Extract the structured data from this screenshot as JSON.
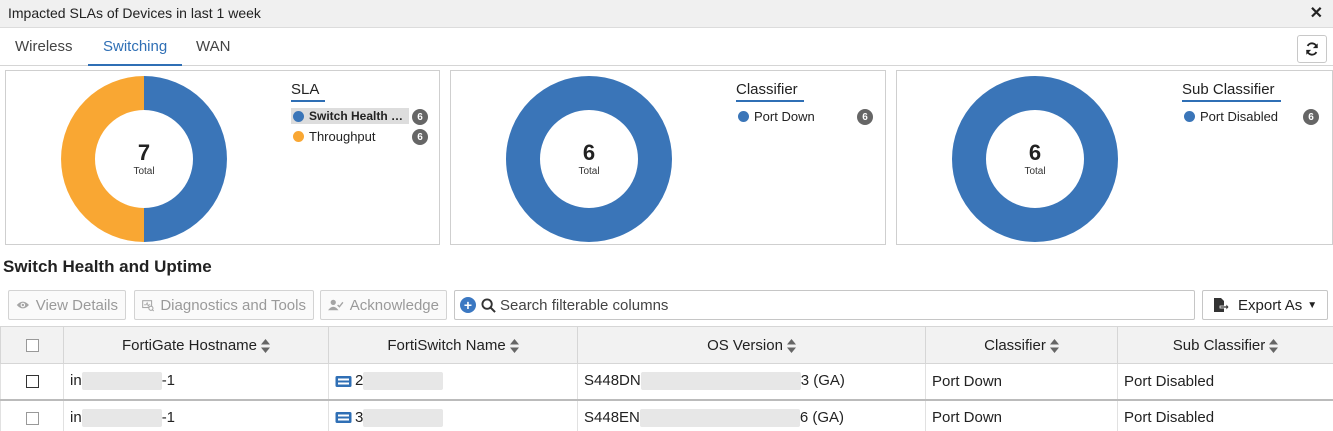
{
  "window": {
    "title": "Impacted SLAs of Devices in last 1 week"
  },
  "tabs": [
    {
      "label": "Wireless"
    },
    {
      "label": "Switching"
    },
    {
      "label": "WAN"
    }
  ],
  "active_tab": "Switching",
  "panels": [
    {
      "total": "7",
      "total_label": "Total",
      "legend_title": "SLA",
      "items": [
        {
          "label": "Switch Health an...",
          "count": "6",
          "color": "#3a75b8"
        },
        {
          "label": "Throughput",
          "count": "6",
          "color": "#f9a733"
        }
      ]
    },
    {
      "total": "6",
      "total_label": "Total",
      "legend_title": "Classifier",
      "items": [
        {
          "label": "Port Down",
          "count": "6",
          "color": "#3a75b8"
        }
      ]
    },
    {
      "total": "6",
      "total_label": "Total",
      "legend_title": "Sub Classifier",
      "items": [
        {
          "label": "Port Disabled",
          "count": "6",
          "color": "#3a75b8"
        }
      ]
    }
  ],
  "chart_data": [
    {
      "type": "pie",
      "categories": [
        "Switch Health an...",
        "Throughput"
      ],
      "values": [
        1,
        1
      ],
      "colors": [
        "#3a75b8",
        "#f9a733"
      ]
    },
    {
      "type": "pie",
      "categories": [
        "Port Down"
      ],
      "values": [
        6
      ],
      "colors": [
        "#3a75b8"
      ]
    },
    {
      "type": "pie",
      "categories": [
        "Port Disabled"
      ],
      "values": [
        6
      ],
      "colors": [
        "#3a75b8"
      ]
    }
  ],
  "section": {
    "title": "Switch Health and Uptime"
  },
  "toolbar": {
    "view_details": "View Details",
    "diagnostics": "Diagnostics and Tools",
    "acknowledge": "Acknowledge",
    "search_placeholder": "Search filterable columns",
    "export": "Export As"
  },
  "table": {
    "headers": [
      "FortiGate Hostname",
      "FortiSwitch Name",
      "OS Version",
      "Classifier",
      "Sub Classifier"
    ],
    "rows": [
      {
        "hostname_prefix": "in",
        "hostname_suffix": "-1",
        "switch_prefix": "2",
        "os_prefix": "S448DN",
        "os_suffix": "3 (GA)",
        "classifier": "Port Down",
        "sub_classifier": "Port Disabled"
      },
      {
        "hostname_prefix": "in",
        "hostname_suffix": "-1",
        "switch_prefix": "3",
        "os_prefix": "S448EN",
        "os_suffix": "6 (GA)",
        "classifier": "Port Down",
        "sub_classifier": "Port Disabled"
      }
    ]
  }
}
